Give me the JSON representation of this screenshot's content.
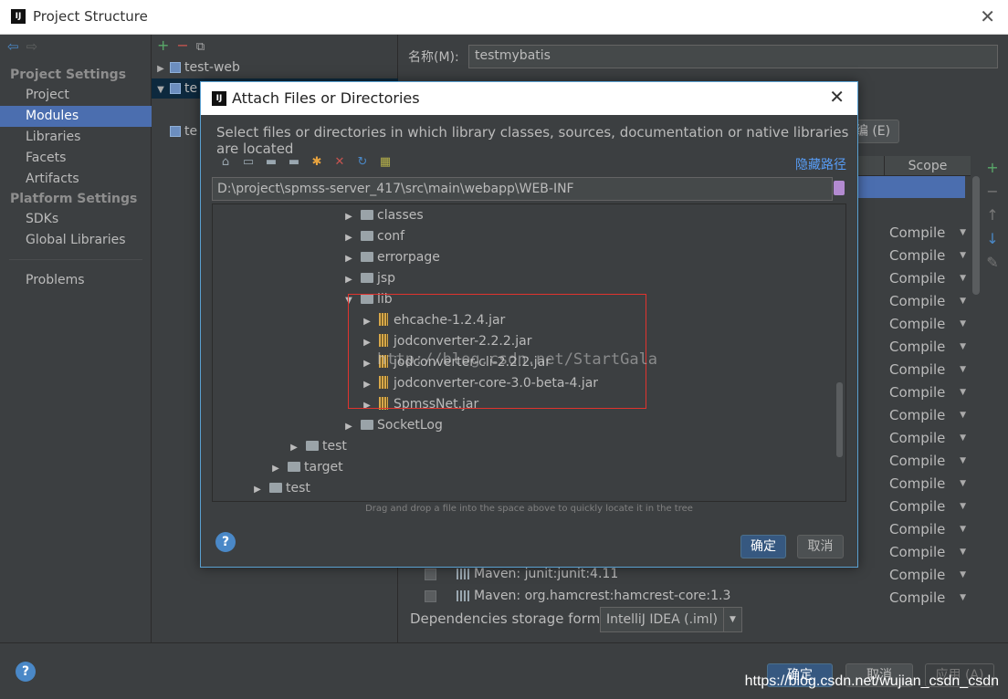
{
  "window": {
    "title": "Project Structure",
    "logo": "IJ"
  },
  "nav": {
    "project_settings_header": "Project Settings",
    "project_items": [
      "Project",
      "Modules",
      "Libraries",
      "Facets",
      "Artifacts"
    ],
    "selected": "Modules",
    "platform_settings_header": "Platform Settings",
    "platform_items": [
      "SDKs",
      "Global Libraries"
    ],
    "problems": "Problems"
  },
  "modules_tree": {
    "rows": [
      {
        "arrow": "▶",
        "label": "test-web"
      },
      {
        "arrow": "▼",
        "label": "te"
      },
      {
        "arrow": "",
        "label": "te"
      }
    ]
  },
  "module_panel": {
    "name_label": "名称(M):",
    "name_value": "testmybatis",
    "edit_button": "编 (E)",
    "scope_header": "Scope",
    "scope_value": "Compile",
    "scope_rows": 17,
    "maven_rows": [
      "Maven: junit:junit:4.11",
      "Maven: org.hamcrest:hamcrest-core:1.3"
    ],
    "storage_label": "Dependencies storage format:",
    "storage_value": "IntelliJ IDEA (.iml)"
  },
  "bottom": {
    "ok": "确定",
    "cancel": "取消",
    "apply": "应用 (A)",
    "watermark": "https://blog.csdn.net/wujian_csdn_csdn"
  },
  "dialog": {
    "logo": "IJ",
    "title": "Attach Files or Directories",
    "description": "Select files or directories in which library classes, sources, documentation or native libraries are located",
    "hide_path": "隐藏路径",
    "path": "D:\\project\\spmss-server_417\\src\\main\\webapp\\WEB-INF",
    "tree": [
      {
        "arrow": "▶",
        "type": "folder",
        "label": "classes"
      },
      {
        "arrow": "▶",
        "type": "folder",
        "label": "conf"
      },
      {
        "arrow": "▶",
        "type": "folder",
        "label": "errorpage"
      },
      {
        "arrow": "▶",
        "type": "folder",
        "label": "jsp"
      },
      {
        "arrow": "▼",
        "type": "folder",
        "label": "lib"
      },
      {
        "arrow": "▶",
        "type": "jar",
        "label": "ehcache-1.2.4.jar"
      },
      {
        "arrow": "▶",
        "type": "jar",
        "label": "jodconverter-2.2.2.jar"
      },
      {
        "arrow": "▶",
        "type": "jar",
        "label": "jodconverter-cli-2.2.2.jar"
      },
      {
        "arrow": "▶",
        "type": "jar",
        "label": "jodconverter-core-3.0-beta-4.jar"
      },
      {
        "arrow": "▶",
        "type": "jar",
        "label": "SpmssNet.jar"
      },
      {
        "arrow": "▶",
        "type": "folder",
        "label": "SocketLog"
      },
      {
        "arrow": "▶",
        "type": "folder",
        "label": "test"
      },
      {
        "arrow": "▶",
        "type": "folder",
        "label": "target"
      },
      {
        "arrow": "▶",
        "type": "folder",
        "label": "test"
      }
    ],
    "watermark": "http://blog.csdn.net/StartGala",
    "drop_hint": "Drag and drop a file into the space above to quickly locate it in the tree",
    "ok": "确定",
    "cancel": "取消",
    "help": "?"
  },
  "colors": {
    "accent": "#4b6eaf",
    "link": "#589df6",
    "highlight_box": "#e0332e"
  }
}
